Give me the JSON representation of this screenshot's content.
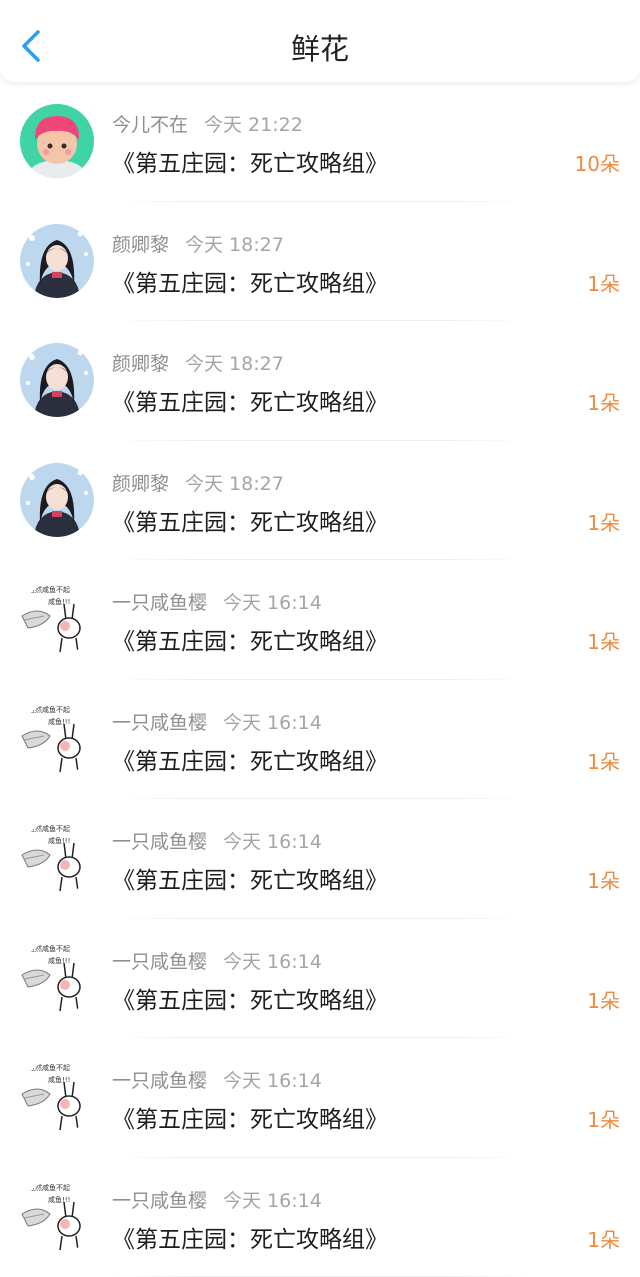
{
  "header": {
    "title": "鲜花",
    "back_icon": "chevron-left-icon",
    "accent": "#2a9df4"
  },
  "colors": {
    "count": "#f08a3c",
    "name": "#8f8f8f",
    "title": "#1f1f1f"
  },
  "items": [
    {
      "user": "今儿不在",
      "time": "今天 21:22",
      "work": "《第五庄园：死亡攻略组》",
      "count": "10朵",
      "avatar": "pink-hair-avatar"
    },
    {
      "user": "颜卿黎",
      "time": "今天 18:27",
      "work": "《第五庄园：死亡攻略组》",
      "count": "1朵",
      "avatar": "anime-girl-avatar"
    },
    {
      "user": "颜卿黎",
      "time": "今天 18:27",
      "work": "《第五庄园：死亡攻略组》",
      "count": "1朵",
      "avatar": "anime-girl-avatar"
    },
    {
      "user": "颜卿黎",
      "time": "今天 18:27",
      "work": "《第五庄园：死亡攻略组》",
      "count": "1朵",
      "avatar": "anime-girl-avatar"
    },
    {
      "user": "一只咸鱼樱",
      "time": "今天 16:14",
      "work": "《第五庄园：死亡攻略组》",
      "count": "1朵",
      "avatar": "rabbit-meme-avatar"
    },
    {
      "user": "一只咸鱼樱",
      "time": "今天 16:14",
      "work": "《第五庄园：死亡攻略组》",
      "count": "1朵",
      "avatar": "rabbit-meme-avatar"
    },
    {
      "user": "一只咸鱼樱",
      "time": "今天 16:14",
      "work": "《第五庄园：死亡攻略组》",
      "count": "1朵",
      "avatar": "rabbit-meme-avatar"
    },
    {
      "user": "一只咸鱼樱",
      "time": "今天 16:14",
      "work": "《第五庄园：死亡攻略组》",
      "count": "1朵",
      "avatar": "rabbit-meme-avatar"
    },
    {
      "user": "一只咸鱼樱",
      "time": "今天 16:14",
      "work": "《第五庄园：死亡攻略组》",
      "count": "1朵",
      "avatar": "rabbit-meme-avatar"
    },
    {
      "user": "一只咸鱼樱",
      "time": "今天 16:14",
      "work": "《第五庄园：死亡攻略组》",
      "count": "1朵",
      "avatar": "rabbit-meme-avatar"
    }
  ]
}
